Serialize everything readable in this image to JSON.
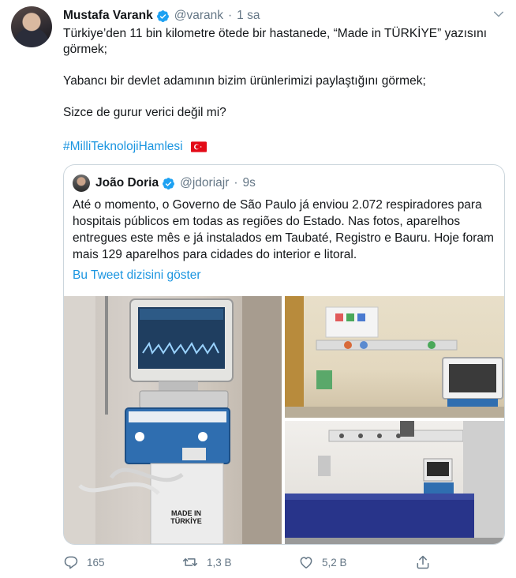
{
  "tweet": {
    "author_name": "Mustafa Varank",
    "author_handle": "@varank",
    "separator": "·",
    "time": "1 sa",
    "lines": [
      "Türkiye’den 11 bin kilometre ötede bir hastanede, “Made in TÜRKİYE” yazısını görmek;",
      "Yabancı bir devlet adamının bizim ürünlerimizi paylaştığını görmek;",
      "Sizce de gurur verici değil mi?"
    ],
    "hashtag": "#MilliTeknolojiHamlesi"
  },
  "quoted": {
    "author_name": "João Doria",
    "author_handle": "@jdoriajr",
    "separator": "·",
    "time": "9s",
    "text": "Até o momento, o Governo de São Paulo já enviou 2.072 respiradores para hospitais públicos em todas as regiões do Estado. Nas fotos, aparelhos entregues este mês e já instalados em Taubaté, Registro e Bauru. Hoje foram mais 129 aparelhos para cidades do interior e litoral.",
    "thread_link": "Bu Tweet dizisini göster",
    "image_caption_line1": "MADE IN",
    "image_caption_line2": "TÜRKİYE"
  },
  "actions": {
    "replies": "165",
    "retweets": "1,3 B",
    "likes": "5,2 B"
  },
  "colors": {
    "link": "#1b95e0",
    "muted": "#657786",
    "border": "#ccd6dd",
    "verified": "#1da1f2"
  },
  "icons": [
    "verified-icon",
    "chevron-down-icon",
    "turkey-flag-icon",
    "reply-icon",
    "retweet-icon",
    "like-icon",
    "share-icon"
  ]
}
